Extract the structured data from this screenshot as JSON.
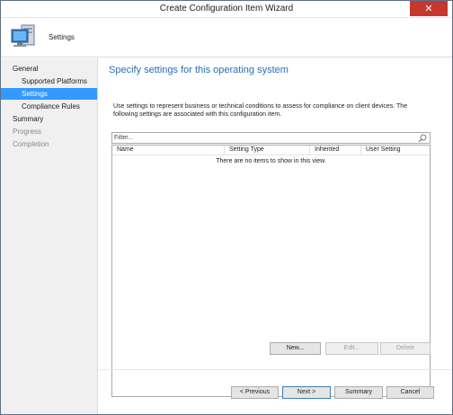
{
  "window": {
    "title": "Create Configuration Item Wizard",
    "close_glyph": "✕"
  },
  "header": {
    "title": "Settings",
    "icon": "computer-settings-icon"
  },
  "nav": {
    "items": [
      {
        "label": "General",
        "level": "top",
        "state": "normal"
      },
      {
        "label": "Supported Platforms",
        "level": "sub",
        "state": "normal"
      },
      {
        "label": "Settings",
        "level": "sub",
        "state": "selected"
      },
      {
        "label": "Compliance Rules",
        "level": "sub",
        "state": "normal"
      },
      {
        "label": "Summary",
        "level": "top",
        "state": "normal"
      },
      {
        "label": "Progress",
        "level": "top",
        "state": "disabled"
      },
      {
        "label": "Completion",
        "level": "top",
        "state": "disabled"
      }
    ]
  },
  "main": {
    "heading": "Specify settings for this operating system",
    "description": "Use settings to represent business or technical conditions to assess for compliance on client devices. The following settings are associated with this configuration item.",
    "filter": {
      "placeholder": "Filter...",
      "value": ""
    },
    "grid": {
      "columns": [
        "Name",
        "Setting Type",
        "Inherited",
        "User Setting"
      ],
      "empty_message": "There are no items to show in this view."
    },
    "actions": {
      "new": "New...",
      "edit": "Edit...",
      "delete": "Delete"
    }
  },
  "footer": {
    "previous": "< Previous",
    "next": "Next >",
    "summary": "Summary",
    "cancel": "Cancel"
  },
  "colors": {
    "accent_heading": "#2a6cb3",
    "selected_nav": "#3399ff",
    "close_button": "#c7372f"
  }
}
